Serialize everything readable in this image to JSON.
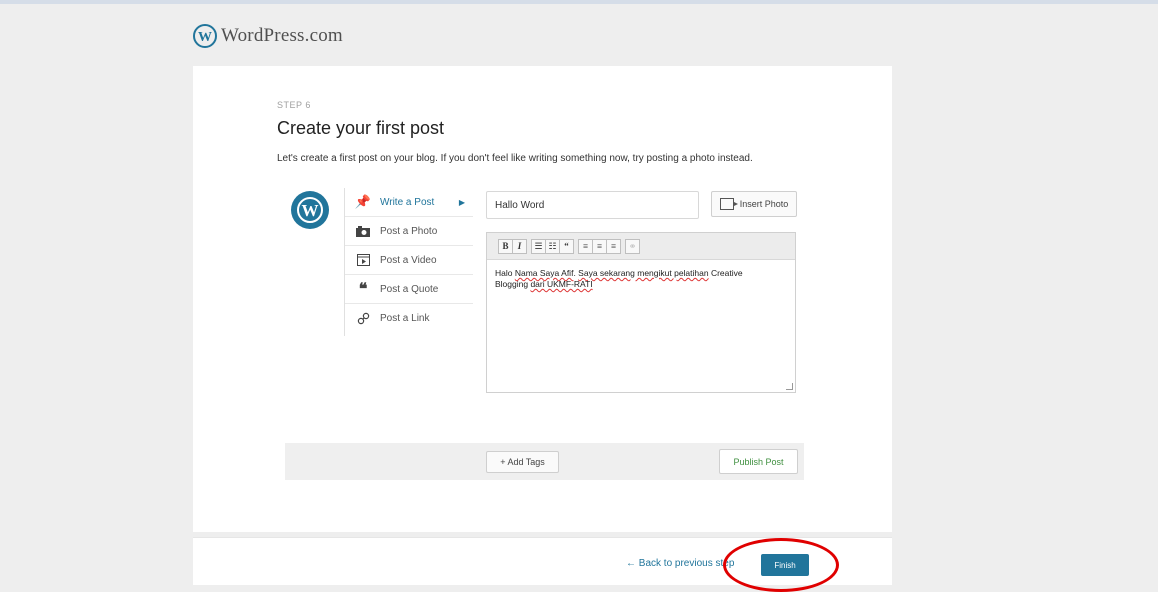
{
  "brand": {
    "logo_text": "WordPress.com"
  },
  "step": {
    "label": "STEP 6",
    "title": "Create your first post",
    "intro": "Let's create a first post on your blog. If you don't feel like writing something now, try posting a photo instead."
  },
  "menu": {
    "items": [
      {
        "label": "Write a Post",
        "icon": "pushpin-icon",
        "active": true
      },
      {
        "label": "Post a Photo",
        "icon": "camera-icon"
      },
      {
        "label": "Post a Video",
        "icon": "video-icon"
      },
      {
        "label": "Post a Quote",
        "icon": "quote-icon"
      },
      {
        "label": "Post a Link",
        "icon": "link-icon"
      }
    ]
  },
  "editor": {
    "title_value": "Hallo Word",
    "insert_photo_label": "Insert Photo",
    "toolbar": [
      "B",
      "I",
      "bulleted-list",
      "numbered-list",
      "blockquote",
      "align-left",
      "align-center",
      "align-right",
      "link"
    ],
    "body_line1_a": "Halo ",
    "body_line1_b": "Nama Saya Afif",
    "body_line1_c": ". ",
    "body_line1_d": "Saya sekarang mengikut pelatihan",
    "body_line1_e": " Creative",
    "body_line2_a": "Blogging ",
    "body_line2_b": "dari UKMF-RATI"
  },
  "actions": {
    "add_tags": "+ Add Tags",
    "publish": "Publish Post"
  },
  "footer": {
    "back": "← Back to previous step",
    "finish": "Finish"
  },
  "colors": {
    "accent": "#21759b",
    "annotation": "#e00000",
    "publish_text": "#3f8f3f"
  }
}
